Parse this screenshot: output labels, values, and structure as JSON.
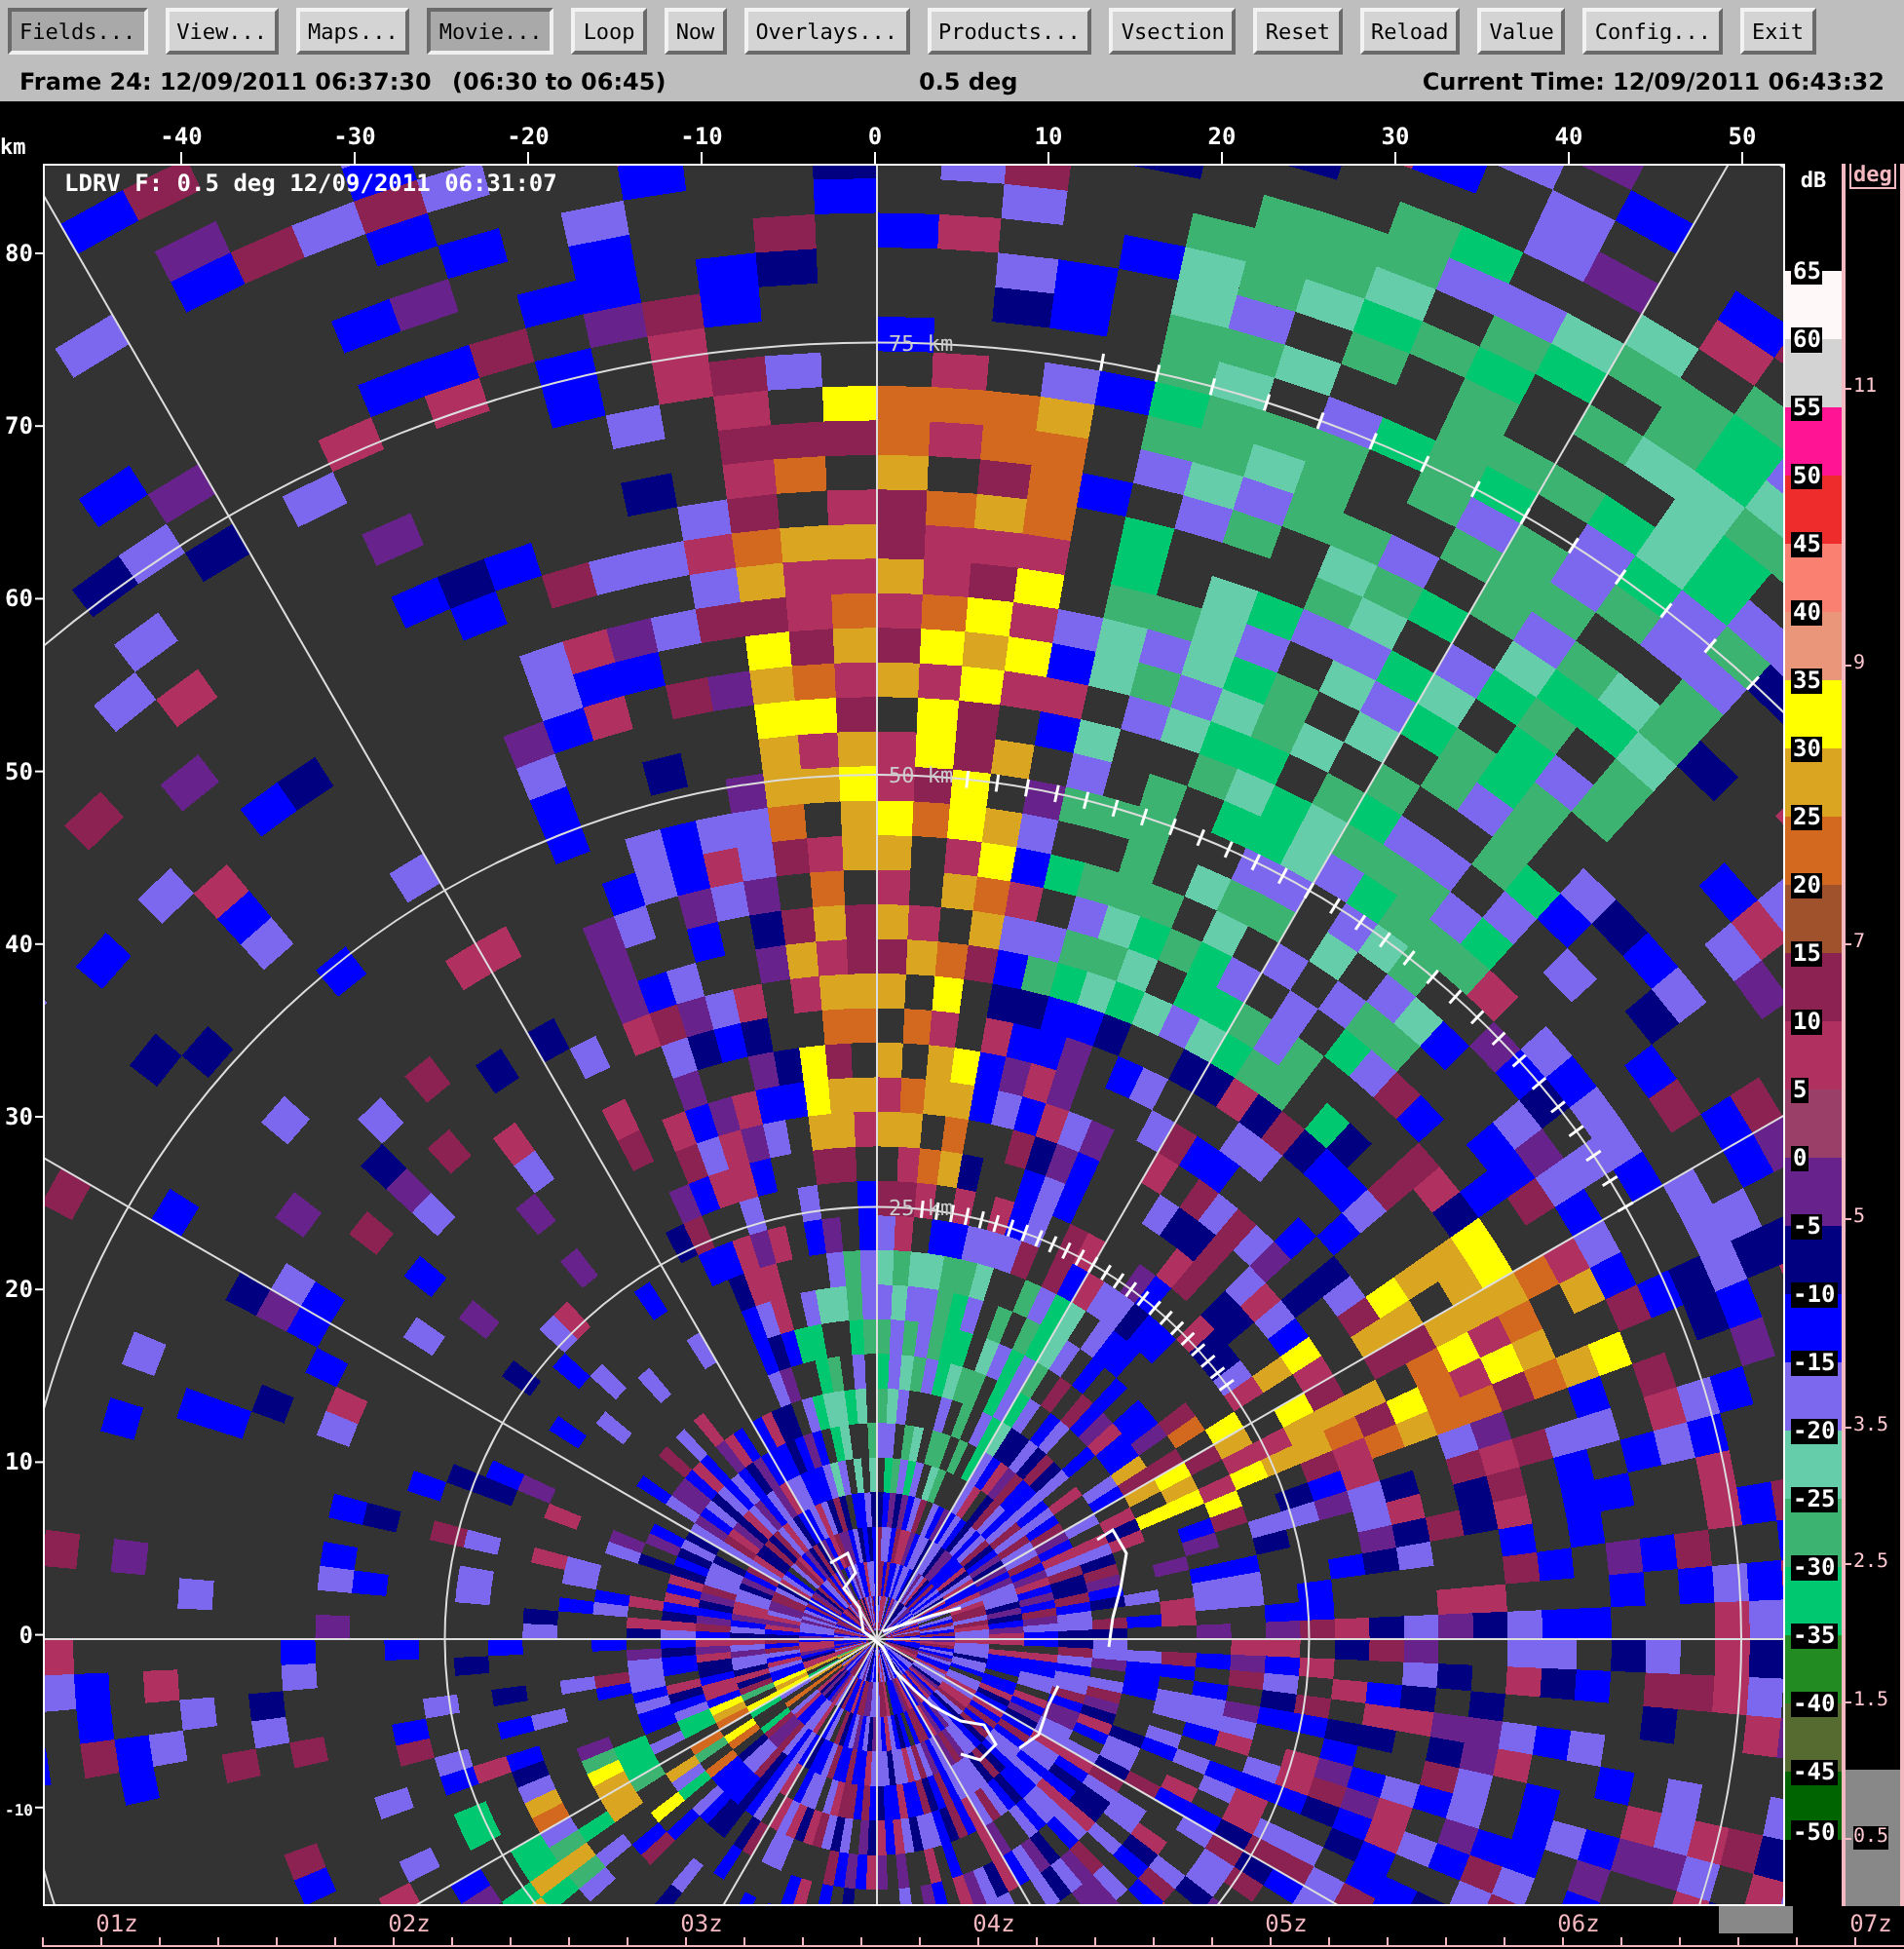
{
  "toolbar": {
    "buttons": [
      {
        "label": "Fields...",
        "pressed": true
      },
      {
        "label": "View...",
        "pressed": false
      },
      {
        "label": "Maps...",
        "pressed": false
      },
      {
        "label": "Movie...",
        "pressed": true
      },
      {
        "label": "Loop",
        "pressed": false
      },
      {
        "label": "Now",
        "pressed": false
      },
      {
        "label": "Overlays...",
        "pressed": false
      },
      {
        "label": "Products...",
        "pressed": false
      },
      {
        "label": "Vsection",
        "pressed": false
      },
      {
        "label": "Reset",
        "pressed": false
      },
      {
        "label": "Reload",
        "pressed": false
      },
      {
        "label": "Value",
        "pressed": false
      },
      {
        "label": "Config...",
        "pressed": false
      },
      {
        "label": "Exit",
        "pressed": false
      }
    ]
  },
  "status_bar": {
    "frame": "Frame 24: 12/09/2011 06:37:30",
    "interval": "(06:30 to 06:45)",
    "elevation": "0.5 deg",
    "current_time": "Current Time: 12/09/2011 06:43:32"
  },
  "plot": {
    "overlay_label": "LDRV F: 0.5 deg 12/09/2011 06:31:07",
    "x_unit": "km",
    "x_ticks": [
      "-40",
      "-30",
      "-20",
      "-10",
      "0",
      "10",
      "20",
      "30",
      "40",
      "50"
    ],
    "y_ticks": [
      "80",
      "70",
      "60",
      "50",
      "40",
      "30",
      "20",
      "10",
      "0",
      "-10"
    ],
    "range_labels": [
      "75 km",
      "50 km",
      "25 km"
    ]
  },
  "color_scale": {
    "unit": "dB",
    "labels": [
      "65",
      "60",
      "55",
      "50",
      "45",
      "40",
      "35",
      "30",
      "25",
      "20",
      "15",
      "10",
      "5",
      "0",
      "-5",
      "-10",
      "-15",
      "-20",
      "-25",
      "-30",
      "-35",
      "-40",
      "-45",
      "-50"
    ],
    "bands": [
      {
        "color": "#fff8f8"
      },
      {
        "color": "#d3d3d3"
      },
      {
        "color": "#ff1493"
      },
      {
        "color": "#ee2c2c"
      },
      {
        "color": "#fa8072"
      },
      {
        "color": "#e9967a"
      },
      {
        "color": "#ffff00"
      },
      {
        "color": "#daa520"
      },
      {
        "color": "#d2691e"
      },
      {
        "color": "#a0522d"
      },
      {
        "color": "#8b2252"
      },
      {
        "color": "#b03060"
      },
      {
        "color": "#9a4068"
      },
      {
        "color": "#68228b"
      },
      {
        "color": "#000080"
      },
      {
        "color": "#0000ff"
      },
      {
        "color": "#7b68ee"
      },
      {
        "color": "#66cdaa"
      },
      {
        "color": "#3cb371"
      },
      {
        "color": "#00c870"
      },
      {
        "color": "#228b22"
      },
      {
        "color": "#556b2f"
      },
      {
        "color": "#006400"
      }
    ]
  },
  "elevation_scale": {
    "unit": "deg",
    "ticks": [
      "11",
      "9",
      "7",
      "5",
      "3.5",
      "2.5",
      "1.5",
      "0.5"
    ]
  },
  "time_axis": {
    "ticks": [
      "01z",
      "02z",
      "03z",
      "04z",
      "05z",
      "06z",
      "07z"
    ]
  }
}
